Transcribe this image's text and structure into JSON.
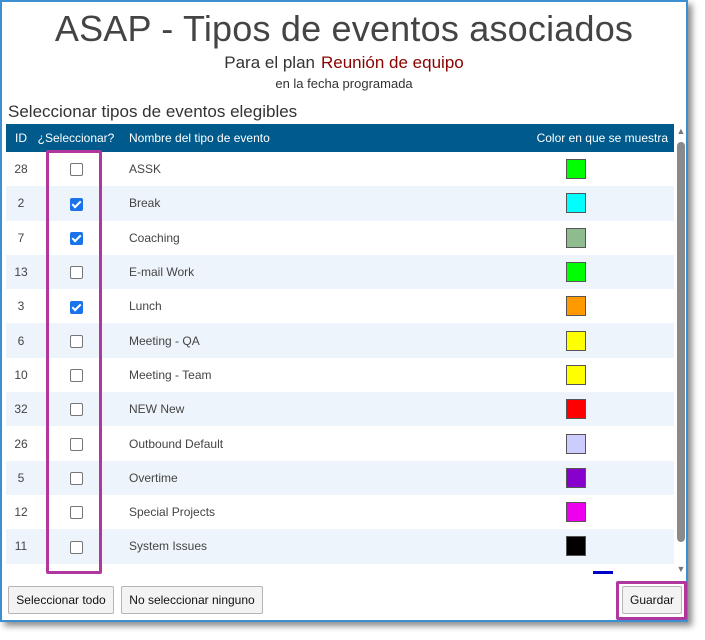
{
  "header": {
    "title": "ASAP - Tipos de eventos asociados",
    "plan_prefix": "Para el plan",
    "plan_name": "Reunión de equipo",
    "date_note": "en la fecha programada"
  },
  "section_title": "Seleccionar tipos de eventos elegibles",
  "table": {
    "columns": {
      "id": "ID",
      "select": "¿Seleccionar?",
      "name": "Nombre del tipo de evento",
      "color": "Color en que se muestra"
    },
    "rows": [
      {
        "id": "28",
        "checked": false,
        "name": "ASSK",
        "color": "#00ff00"
      },
      {
        "id": "2",
        "checked": true,
        "name": "Break",
        "color": "#00ffff"
      },
      {
        "id": "7",
        "checked": true,
        "name": "Coaching",
        "color": "#8fbc8f"
      },
      {
        "id": "13",
        "checked": false,
        "name": "E-mail Work",
        "color": "#00ff00"
      },
      {
        "id": "3",
        "checked": true,
        "name": "Lunch",
        "color": "#ff9900"
      },
      {
        "id": "6",
        "checked": false,
        "name": "Meeting - QA",
        "color": "#ffff00"
      },
      {
        "id": "10",
        "checked": false,
        "name": "Meeting - Team",
        "color": "#ffff00"
      },
      {
        "id": "32",
        "checked": false,
        "name": "NEW New",
        "color": "#ff0000"
      },
      {
        "id": "26",
        "checked": false,
        "name": "Outbound Default",
        "color": "#ccccff"
      },
      {
        "id": "5",
        "checked": false,
        "name": "Overtime",
        "color": "#8800cc"
      },
      {
        "id": "12",
        "checked": false,
        "name": "Special Projects",
        "color": "#ee00ee"
      },
      {
        "id": "11",
        "checked": false,
        "name": "System Issues",
        "color": "#000000"
      }
    ]
  },
  "buttons": {
    "select_all": "Seleccionar todo",
    "select_none": "No seleccionar ninguno",
    "save": "Guardar"
  },
  "highlight_color": "#b0379d",
  "header_bg": "#005a8c",
  "plan_color": "#8b0000"
}
